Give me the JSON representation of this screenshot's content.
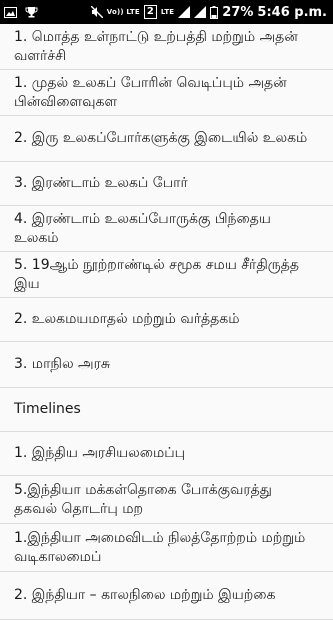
{
  "status_bar": {
    "left_icons": [
      "image-icon",
      "trophy-icon"
    ],
    "volte_label": "Vo)) LTE",
    "sim_label": "2",
    "lte_label": "LTE",
    "battery_percent": "27%",
    "time": "5:46 p.m."
  },
  "items": [
    {
      "label": "1. மொத்த உள்நாட்டு உற்பத்தி மற்றும் அதன் வளர்ச்சி"
    },
    {
      "label": "1. முதல் உலகப் போரின் வெடிப்பும் அதன் பின்விளைவுகள"
    },
    {
      "label": "2. இரு உலகப்போர்களுக்கு இடையில் உலகம்"
    },
    {
      "label": "3. இரண்டாம் உலகப் போர்"
    },
    {
      "label": "4. இரண்டாம் உலகப்போருக்கு பிந்தைய உலகம்"
    },
    {
      "label": "5. 19ஆம் நூற்றாண்டில் சமூக சமய சீர்திருத்த இய"
    },
    {
      "label": "2. உலகமயமாதல் மற்றும் வர்த்தகம்"
    },
    {
      "label": "3. மாநில அரசு"
    },
    {
      "label": "Timelines"
    },
    {
      "label": "1. இந்திய அரசியலமைப்பு"
    },
    {
      "label": "5.இந்தியா மக்கள்தொகை போக்குவரத்து தகவல் தொடர்பு மற"
    },
    {
      "label": "1.இந்தியா அமைவிடம் நிலத்தோற்றம் மற்றும் வடிகாலமைப்"
    },
    {
      "label": "2. இந்தியா – காலநிலை மற்றும் இயற்கை"
    }
  ]
}
